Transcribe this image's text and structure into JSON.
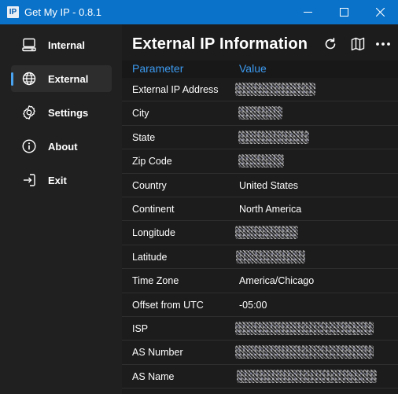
{
  "window": {
    "app_icon_text": "IP",
    "title": "Get My IP - 0.8.1",
    "accent": "#0a72c9"
  },
  "sidebar": {
    "items": [
      {
        "label": "Internal",
        "icon": "computer-icon",
        "active": false
      },
      {
        "label": "External",
        "icon": "globe-icon",
        "active": true
      },
      {
        "label": "Settings",
        "icon": "gear-icon",
        "active": false
      },
      {
        "label": "About",
        "icon": "info-icon",
        "active": false
      },
      {
        "label": "Exit",
        "icon": "exit-icon",
        "active": false
      }
    ]
  },
  "main": {
    "title": "External IP Information",
    "toolbar": [
      "refresh-icon",
      "map-icon",
      "more-icon"
    ],
    "table": {
      "headers": [
        "Parameter",
        "Value"
      ],
      "rows": [
        {
          "param": "External IP Address",
          "value": "",
          "redacted": true
        },
        {
          "param": "City",
          "value": "",
          "redacted": true
        },
        {
          "param": "State",
          "value": "",
          "redacted": true
        },
        {
          "param": "Zip Code",
          "value": "",
          "redacted": true
        },
        {
          "param": "Country",
          "value": "United States",
          "redacted": false
        },
        {
          "param": "Continent",
          "value": "North America",
          "redacted": false
        },
        {
          "param": "Longitude",
          "value": "",
          "redacted": true
        },
        {
          "param": "Latitude",
          "value": "",
          "redacted": true
        },
        {
          "param": "Time Zone",
          "value": "America/Chicago",
          "redacted": false
        },
        {
          "param": "Offset from UTC",
          "value": "-05:00",
          "redacted": false
        },
        {
          "param": "ISP",
          "value": "",
          "redacted": true
        },
        {
          "param": "AS Number",
          "value": "",
          "redacted": true
        },
        {
          "param": "AS Name",
          "value": "",
          "redacted": true
        }
      ]
    }
  },
  "colors": {
    "header_text": "#3c9af0",
    "active_indicator": "#4aa3ef"
  }
}
